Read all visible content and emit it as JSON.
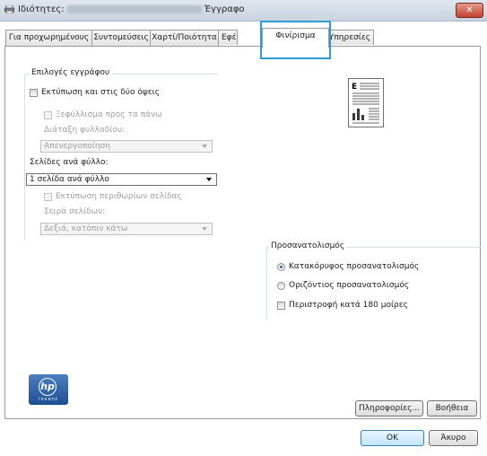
{
  "window": {
    "title_prefix": "Ιδιότητες:",
    "title_suffix": "Έγγραφο",
    "close_label": "✕"
  },
  "tabs": [
    {
      "label": "Για προχωρημένους"
    },
    {
      "label": "Συντομεύσεις"
    },
    {
      "label": "Χαρτί/Ποιότητα"
    },
    {
      "label": "Εφέ"
    },
    {
      "label": "Φινίρισμα"
    },
    {
      "label": "Υπηρεσίες"
    }
  ],
  "document_options": {
    "group_label": "Επιλογές εγγράφου",
    "duplex_label": "Εκτύπωση και στις δύο όψεις",
    "flip_label": "Ξεφύλλισμα προς τα πάνω",
    "booklet_label": "Διάταξη φυλλαδίου:",
    "booklet_value": "Απενεργοποίηση",
    "pages_per_sheet_label": "Σελίδες ανά φύλλο:",
    "pages_per_sheet_value": "1 σελίδα ανά φύλλο",
    "print_borders_label": "Εκτύπωση περιθωρίων σελίδας",
    "page_order_label": "Σειρά σελίδων:",
    "page_order_value": "Δεξιά, κατόπιν κάτω"
  },
  "preview": {
    "letter": "E"
  },
  "orientation": {
    "group_label": "Προσανατολισμός",
    "portrait_label": "Κατακόρυφος προσανατολισμός",
    "landscape_label": "Οριζόντιος προσανατολισμός",
    "rotate_label": "Περιστροφή κατά 180 μοίρες",
    "selected": "portrait"
  },
  "logo": {
    "text": "hp",
    "tagline": "invent"
  },
  "buttons": {
    "about": "Πληροφορίες...",
    "help": "Βοήθεια",
    "ok": "OK",
    "cancel": "Άκυρο"
  },
  "colors": {
    "highlight": "#2e9ad6",
    "accent": "#2b6fc2"
  }
}
